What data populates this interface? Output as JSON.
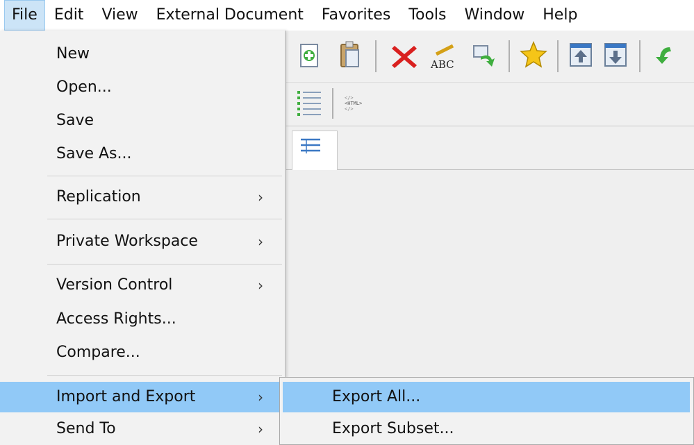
{
  "menubar": {
    "items": [
      "File",
      "Edit",
      "View",
      "External Document",
      "Favorites",
      "Tools",
      "Window",
      "Help"
    ],
    "active": "File"
  },
  "file_menu": {
    "items": [
      {
        "label": "New"
      },
      {
        "label": "Open..."
      },
      {
        "label": "Save"
      },
      {
        "label": "Save As..."
      },
      {
        "label": "Replication",
        "submenu": true
      },
      {
        "label": "Private Workspace",
        "submenu": true
      },
      {
        "label": "Version Control",
        "submenu": true
      },
      {
        "label": "Access Rights..."
      },
      {
        "label": "Compare..."
      },
      {
        "label": "Import and Export",
        "submenu": true,
        "highlighted": true
      },
      {
        "label": "Send To",
        "submenu": true
      }
    ],
    "arrow": "›"
  },
  "submenu": {
    "items": [
      {
        "label": "Export All...",
        "highlighted": true
      },
      {
        "label": "Export Subset..."
      }
    ]
  },
  "toolbar": {
    "icons": [
      "new-document-icon",
      "paste-icon",
      "delete-icon",
      "spell-check-icon",
      "move-icon",
      "favorite-star-icon",
      "move-up-icon",
      "move-down-icon",
      "refresh-icon"
    ]
  },
  "toolbar2": {
    "icons": [
      "list-view-icon",
      "html-view-icon"
    ],
    "html_icon_text": "<HTML>"
  },
  "colors": {
    "highlight": "#91c9f7",
    "menubar_active": "#cce4f7",
    "delete_red": "#d9201f",
    "star_yellow": "#f5c518"
  }
}
